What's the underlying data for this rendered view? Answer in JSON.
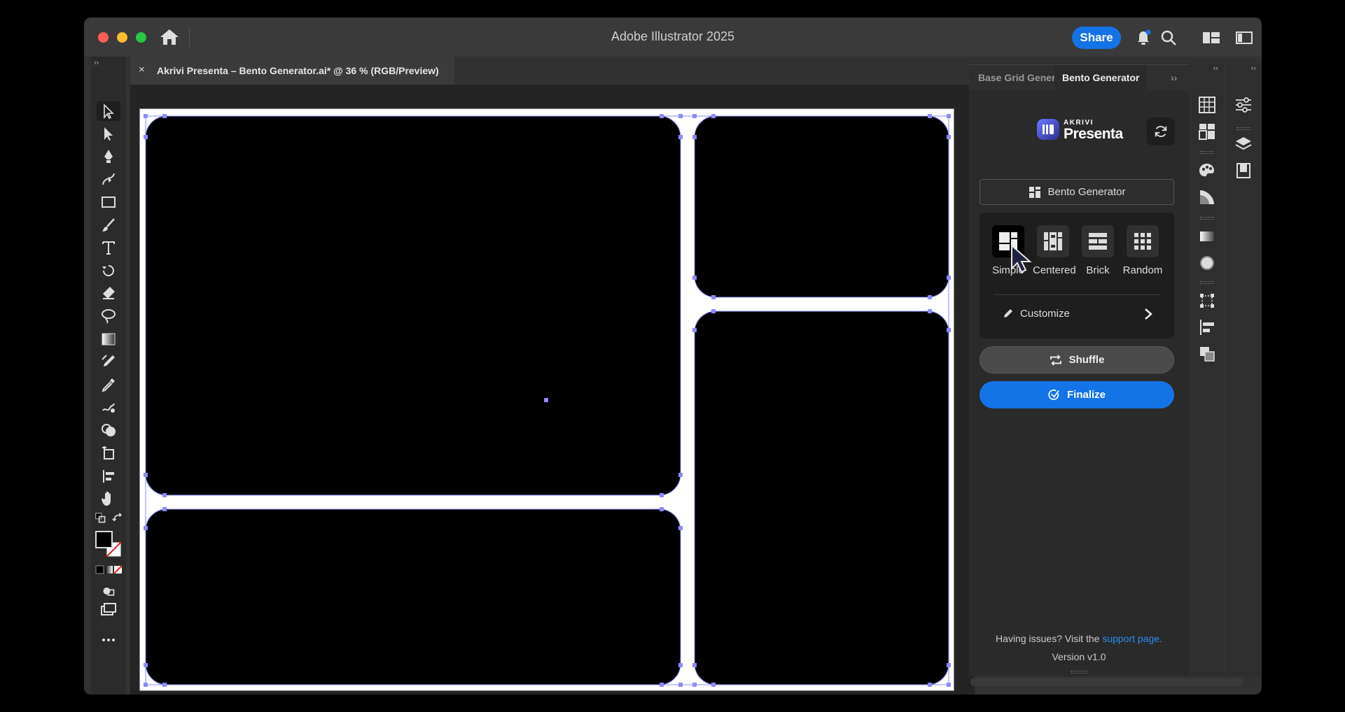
{
  "app": {
    "title": "Adobe Illustrator 2025",
    "share_label": "Share"
  },
  "document": {
    "tab_title": "Akrivi Presenta – Bento Generator.ai* @ 36 % (RGB/Preview)",
    "close_symbol": "×"
  },
  "panel": {
    "tabs": [
      {
        "label": "Base Grid Generator"
      },
      {
        "label": "Bento Generator"
      }
    ],
    "more_symbol": "››",
    "logo_small": "AKRIVI",
    "logo_name": "Presenta",
    "mode_label": "Bento Generator",
    "layouts": [
      {
        "label": "Simple",
        "selected": true
      },
      {
        "label": "Centered",
        "selected": false
      },
      {
        "label": "Brick",
        "selected": false
      },
      {
        "label": "Random",
        "selected": false
      }
    ],
    "customize_label": "Customize",
    "shuffle_label": "Shuffle",
    "finalize_label": "Finalize",
    "help_prefix": "Having issues? Visit the ",
    "help_link": "support page.",
    "version": "Version v1.0"
  },
  "colors": {
    "accent": "#1473e6",
    "selection": "#7b7bff",
    "tile": "#000000"
  },
  "icons": {
    "toolbar": [
      "selection-tool-icon",
      "direct-selection-tool-icon",
      "pen-tool-icon",
      "curvature-tool-icon",
      "rectangle-tool-icon",
      "paintbrush-tool-icon",
      "type-tool-icon",
      "rotate-tool-icon",
      "eraser-tool-icon",
      "lasso-tool-icon",
      "gradient-tool-icon",
      "eyedropper-measure-icon",
      "eyedropper-tool-icon",
      "puppet-warp-icon",
      "shape-builder-icon",
      "artboard-tool-icon",
      "align-tool-icon",
      "hand-tool-icon"
    ],
    "column1": [
      "table-icon",
      "bento-icon",
      "color-palette-icon",
      "curves-icon",
      "gradient-icon",
      "appearance-icon",
      "transform-icon",
      "align-icon",
      "pathfinder-icon"
    ],
    "column2": [
      "properties-icon",
      "layers-icon",
      "libraries-icon"
    ]
  }
}
